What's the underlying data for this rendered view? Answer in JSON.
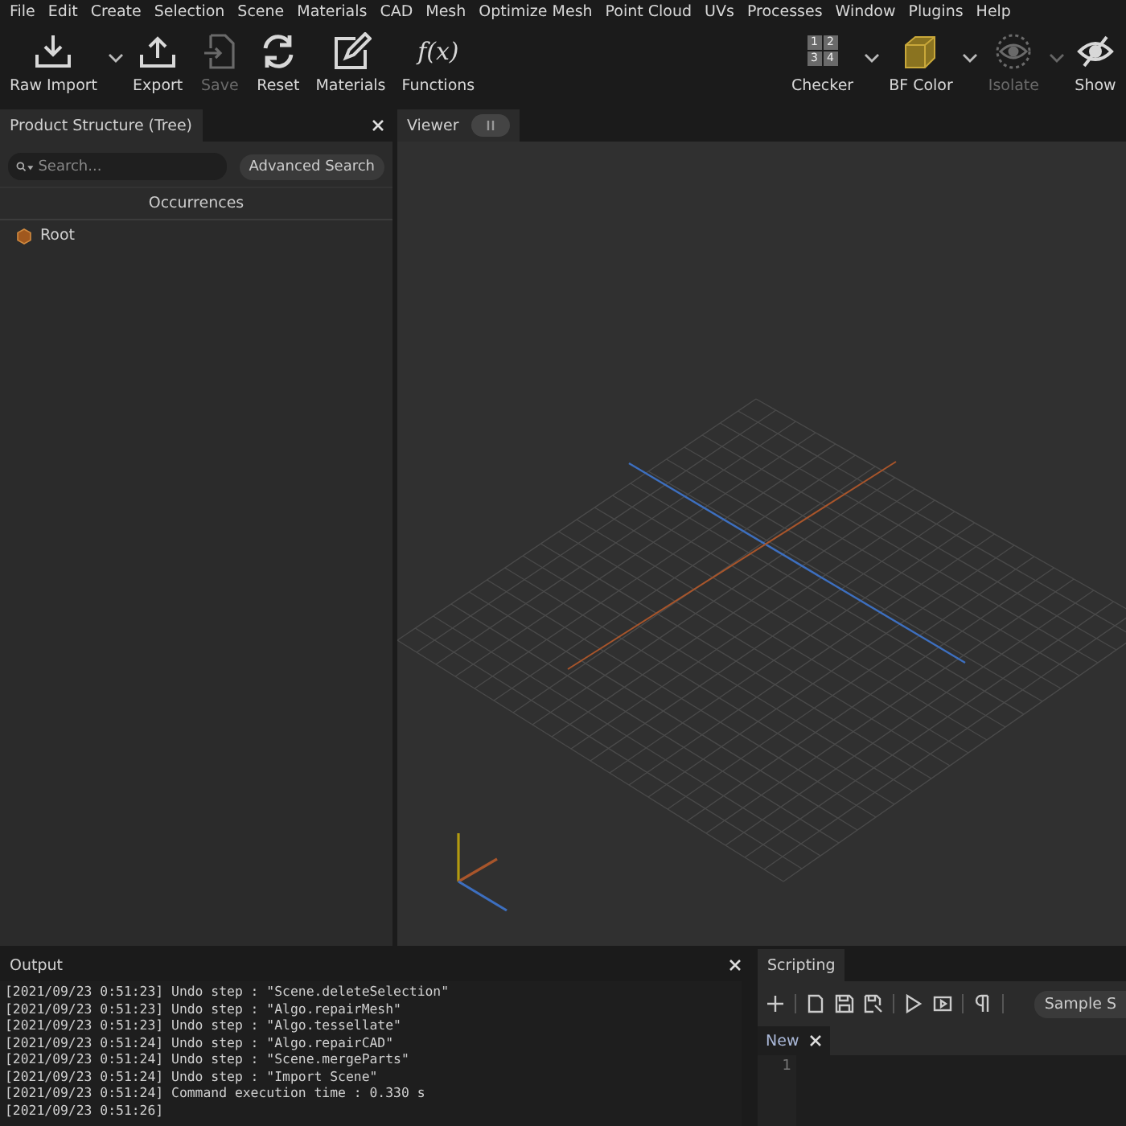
{
  "menu": [
    "File",
    "Edit",
    "Create",
    "Selection",
    "Scene",
    "Materials",
    "CAD",
    "Mesh",
    "Optimize Mesh",
    "Point Cloud",
    "UVs",
    "Processes",
    "Window",
    "Plugins",
    "Help"
  ],
  "toolbar_left": [
    {
      "kind": "import",
      "label": "Raw Import",
      "disabled": false,
      "dropdown": true
    },
    {
      "kind": "export",
      "label": "Export",
      "disabled": false,
      "dropdown": false
    },
    {
      "kind": "save",
      "label": "Save",
      "disabled": true,
      "dropdown": false
    },
    {
      "kind": "reset",
      "label": "Reset",
      "disabled": false,
      "dropdown": false
    },
    {
      "kind": "materials",
      "label": "Materials",
      "disabled": false,
      "dropdown": false
    },
    {
      "kind": "function",
      "label": "Functions",
      "disabled": false,
      "dropdown": false,
      "glyph": "f(x)"
    }
  ],
  "toolbar_right": [
    {
      "kind": "checker",
      "label": "Checker",
      "disabled": false,
      "dropdown": true,
      "digits": [
        "1",
        "2",
        "3",
        "4"
      ]
    },
    {
      "kind": "box",
      "label": "BF Color",
      "disabled": false,
      "dropdown": true
    },
    {
      "kind": "eye",
      "label": "Isolate",
      "disabled": true,
      "dropdown": true
    },
    {
      "kind": "hidden",
      "label": "Show",
      "disabled": false,
      "dropdown": false
    }
  ],
  "tree_panel": {
    "title": "Product Structure (Tree)",
    "search": {
      "placeholder": "Search..."
    },
    "advanced_button": "Advanced Search",
    "column": "Occurrences",
    "items": [
      {
        "label": "Root"
      }
    ]
  },
  "viewer": {
    "title": "Viewer"
  },
  "output": {
    "title": "Output",
    "lines": [
      "[2021/09/23 0:51:23] Undo step : \"Scene.deleteSelection\"",
      "[2021/09/23 0:51:23] Undo step : \"Algo.repairMesh\"",
      "[2021/09/23 0:51:23] Undo step : \"Algo.tessellate\"",
      "[2021/09/23 0:51:24] Undo step : \"Algo.repairCAD\"",
      "[2021/09/23 0:51:24] Undo step : \"Scene.mergeParts\"",
      "[2021/09/23 0:51:24] Undo step : \"Import Scene\"",
      "[2021/09/23 0:51:24] Command execution time : 0.330 s",
      "[2021/09/23 0:51:26]"
    ]
  },
  "scripting": {
    "title": "Scripting",
    "sample_button": "Sample S",
    "tabs": [
      {
        "label": "New",
        "selected": true
      }
    ],
    "line_numbers": [
      "1"
    ]
  }
}
